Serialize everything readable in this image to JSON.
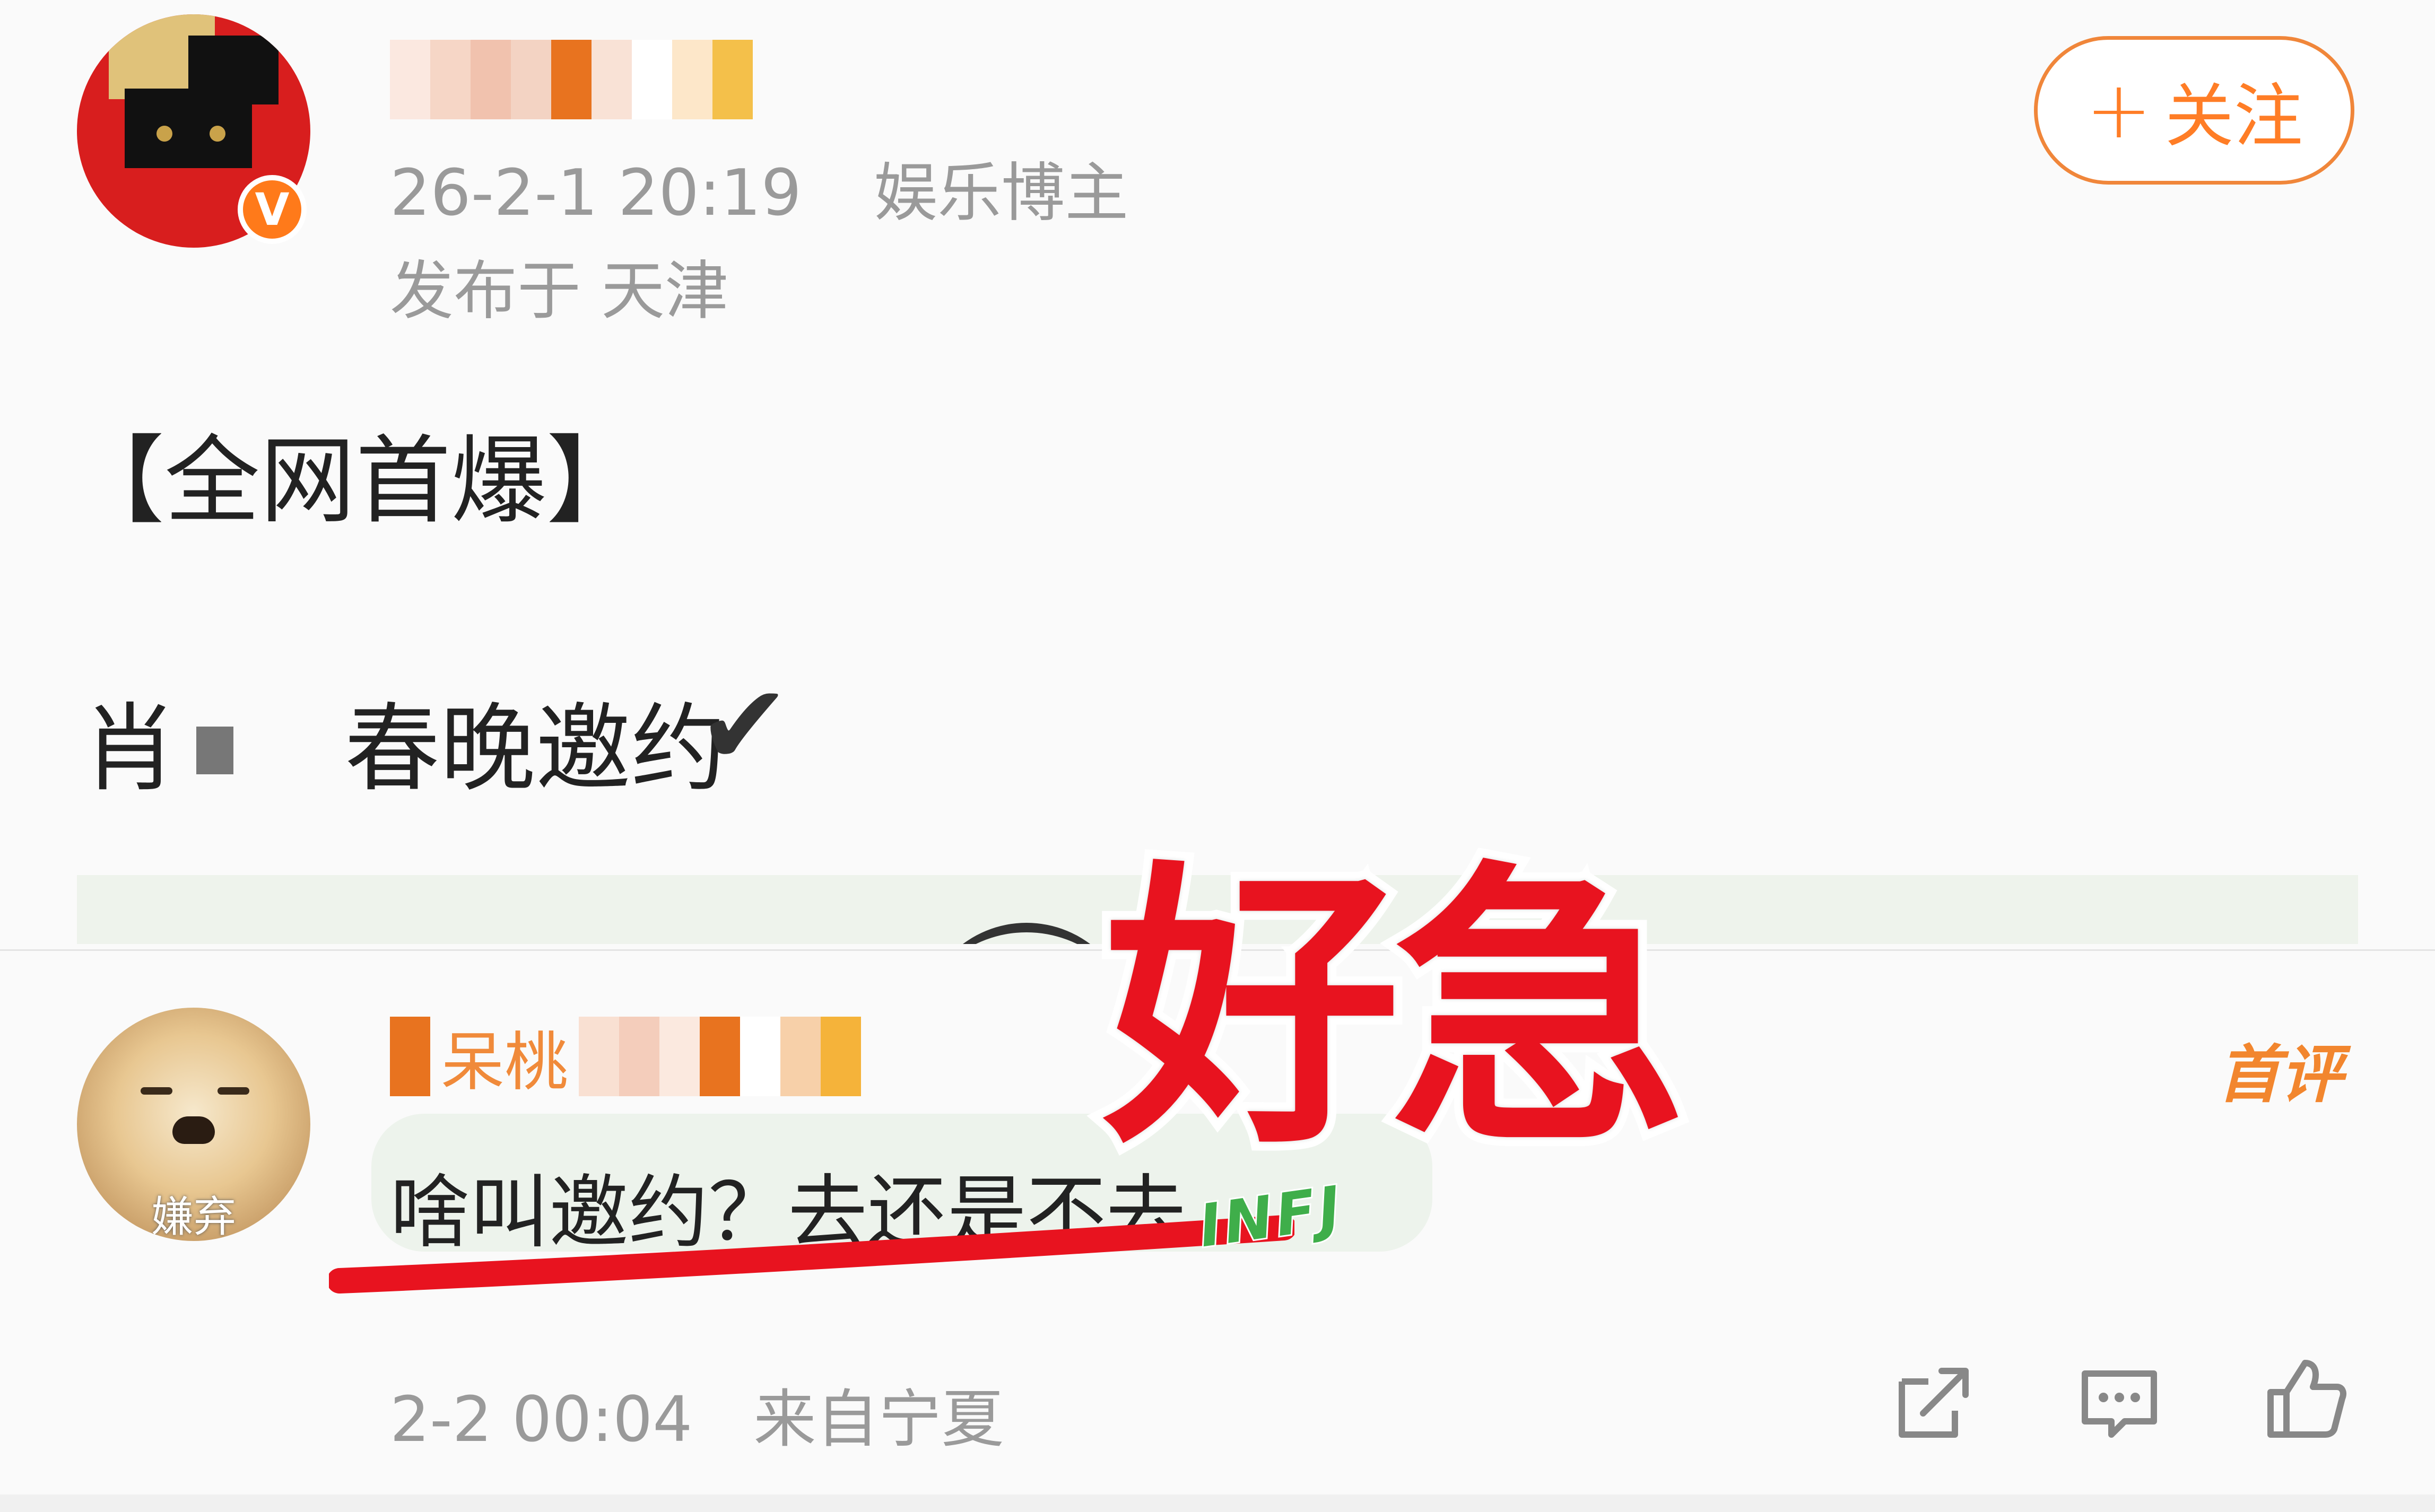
{
  "post": {
    "date": "26-2-1 20:19",
    "author_tag": "娱乐博主",
    "location": "发布于 天津",
    "follow_label": "关注",
    "follow_plus": "+",
    "title": "【全网首爆】",
    "line_prefix": "肖",
    "line_main": "春晚邀约",
    "check": "✔",
    "verified_badge": "V"
  },
  "comment": {
    "username_visible": "呆桃",
    "avatar_caption": "嫌弃",
    "text": "啥叫邀约？去还是不去",
    "badge_infj": "INFJ",
    "first_comment_badge": "首评",
    "time": "2-2 00:04",
    "source": "来自宁夏"
  },
  "overlay": {
    "caption": "好急"
  },
  "colors": {
    "accent_orange": "#ff7d26",
    "overlay_red": "#e8131f",
    "meta_gray": "#9a9a9a"
  },
  "icons": [
    "share-icon",
    "comment-icon",
    "like-icon"
  ]
}
